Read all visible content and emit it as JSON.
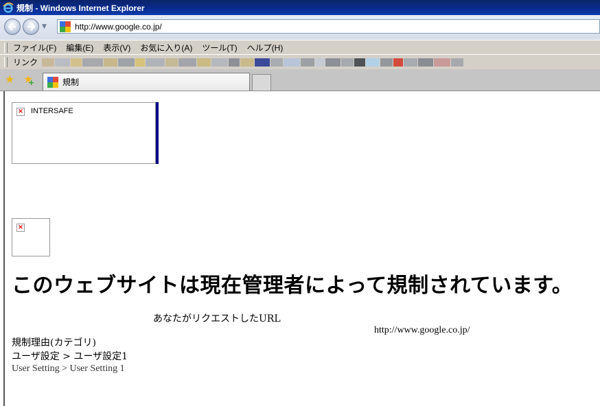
{
  "window": {
    "title": "規制 - Windows Internet Explorer"
  },
  "address_bar": {
    "url": "http://www.google.co.jp/"
  },
  "menu": {
    "items": [
      "ファイル(F)",
      "編集(E)",
      "表示(V)",
      "お気に入り(A)",
      "ツール(T)",
      "ヘルプ(H)"
    ]
  },
  "links_bar": {
    "label": "リンク"
  },
  "tab": {
    "label": "規制"
  },
  "page": {
    "logo_alt": "INTERSAFE",
    "headline": "このウェブサイトは現在管理者によって規制されています。",
    "requested_url_label": "あなたがリクエストしたURL",
    "requested_url": "http://www.google.co.jp/",
    "reason_label": "規制理由(カテゴリ)",
    "category_ja": "ユーザ設定 > ユーザ設定1",
    "category_en": "User Setting > User Setting 1"
  },
  "colors": {
    "title_bar": "#0a246a",
    "logo_bar": "#00008b",
    "toolbar": "#d4d0c8"
  }
}
